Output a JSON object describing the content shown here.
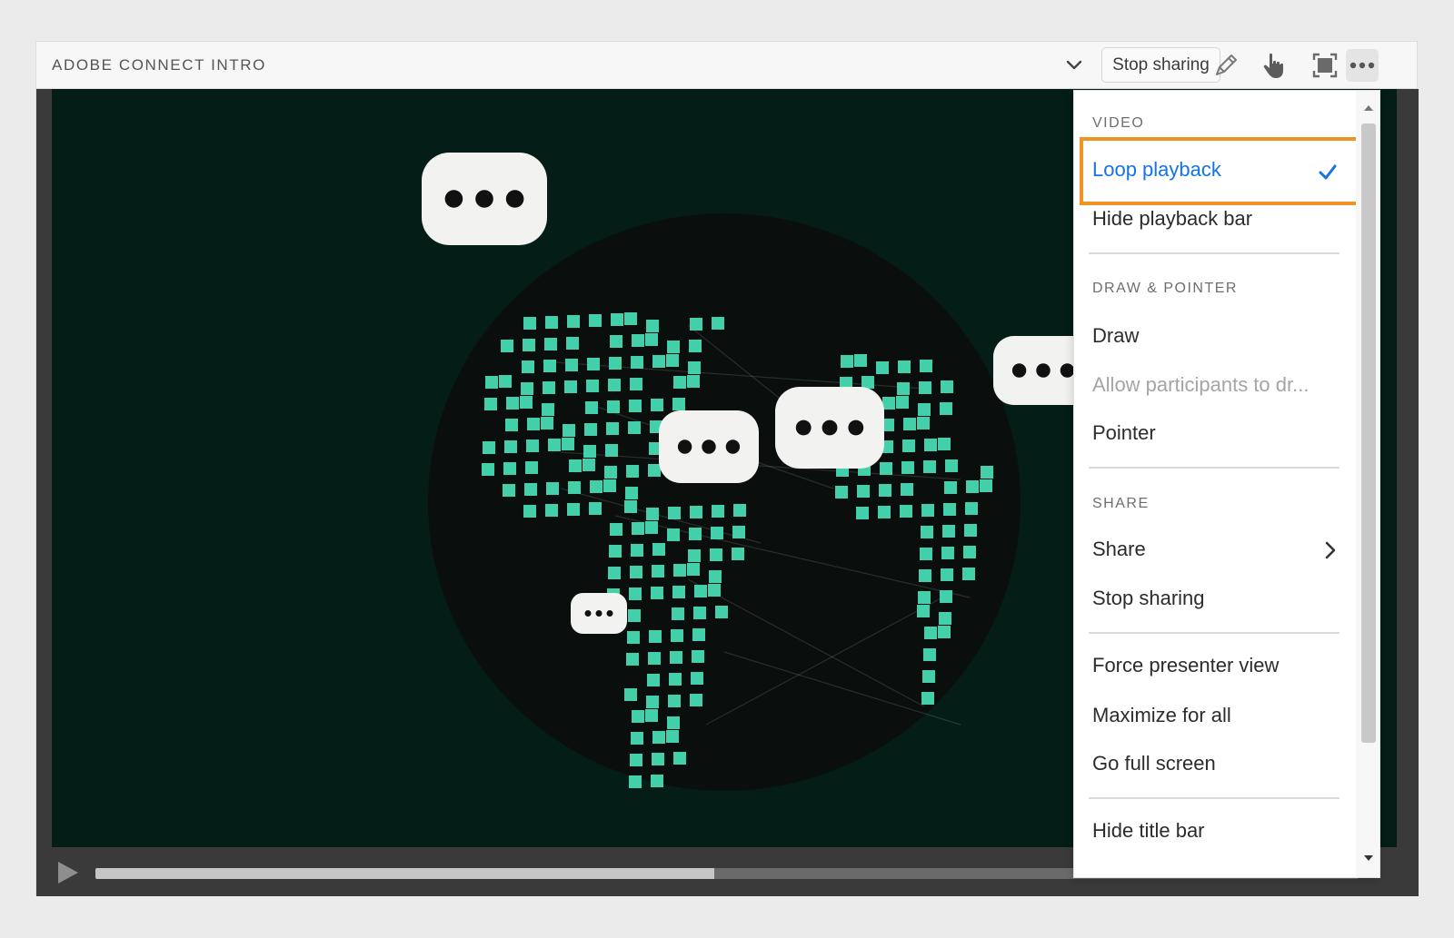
{
  "window": {
    "title": "ADOBE CONNECT INTRO",
    "stop_sharing_label": "Stop sharing"
  },
  "icons": {
    "dropdown": "chevron-down-icon",
    "draw": "pencil-icon",
    "pointer": "hand-pointer-icon",
    "fullscreen": "fullscreen-icon",
    "more": "more-options-icon",
    "play": "play-icon"
  },
  "playback": {
    "progress": 0.49
  },
  "menu": {
    "sections": {
      "video": "VIDEO",
      "draw_pointer": "DRAW & POINTER",
      "share": "SHARE"
    },
    "items": {
      "loop_playback": "Loop playback",
      "hide_playback_bar": "Hide playback bar",
      "draw": "Draw",
      "allow_participants": "Allow participants to dr...",
      "pointer": "Pointer",
      "share": "Share",
      "stop_sharing": "Stop sharing",
      "force_presenter_view": "Force presenter view",
      "maximize_for_all": "Maximize for all",
      "go_full_screen": "Go full screen",
      "hide_title_bar": "Hide title bar"
    }
  },
  "colors": {
    "accent": "#1473e6",
    "highlight": "#f0931f",
    "video_bg": "#051d17",
    "globe": "#0a0f0d",
    "map_dot": "#42cfaa"
  }
}
